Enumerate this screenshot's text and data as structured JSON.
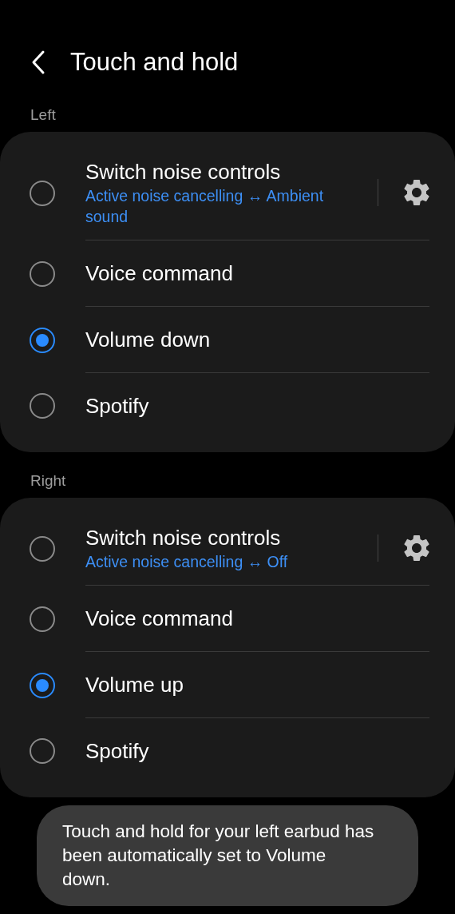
{
  "header": {
    "title": "Touch and hold"
  },
  "sections": [
    {
      "label": "Left",
      "options": [
        {
          "title": "Switch noise controls",
          "subtitle": "Active noise cancelling ↔ Ambient sound",
          "selected": false,
          "settings": true
        },
        {
          "title": "Voice command",
          "selected": false
        },
        {
          "title": "Volume down",
          "selected": true
        },
        {
          "title": "Spotify",
          "selected": false
        }
      ]
    },
    {
      "label": "Right",
      "options": [
        {
          "title": "Switch noise controls",
          "subtitle": "Active noise cancelling ↔ Off",
          "selected": false,
          "settings": true
        },
        {
          "title": "Voice command",
          "selected": false
        },
        {
          "title": "Volume up",
          "selected": true
        },
        {
          "title": "Spotify",
          "selected": false
        }
      ]
    }
  ],
  "toast": "Touch and hold for your left earbud has been automatically set to Volume down."
}
